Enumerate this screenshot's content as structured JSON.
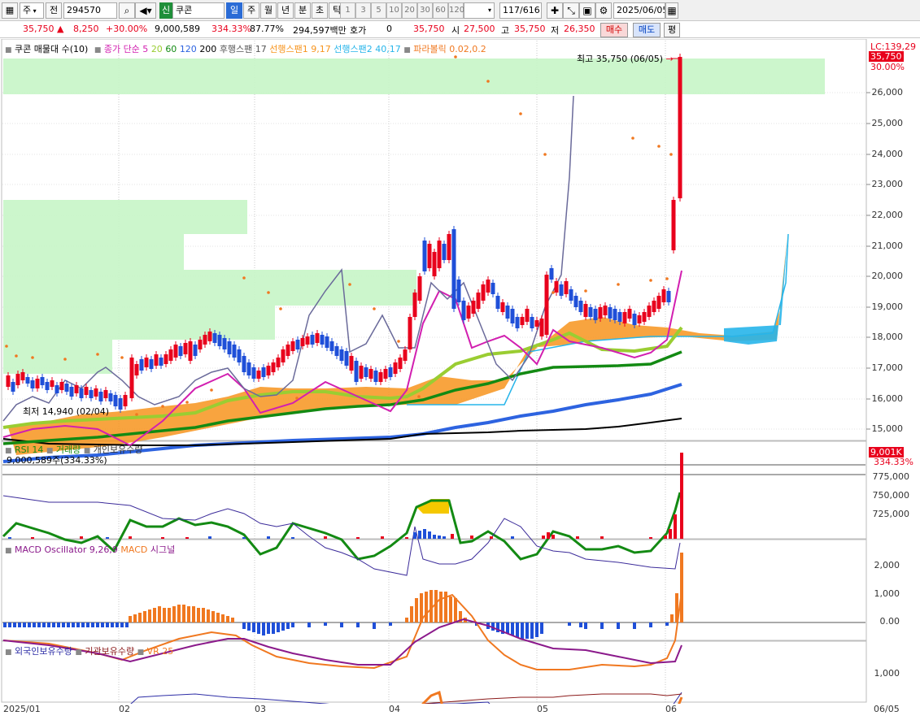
{
  "toolbar": {
    "period_type": "주",
    "prev_label": "전",
    "code": "294570",
    "sign": "신",
    "name": "쿠콘",
    "periods": [
      "일",
      "주",
      "월",
      "년",
      "분",
      "초",
      "틱"
    ],
    "intervals": [
      "1",
      "3",
      "5",
      "10",
      "20",
      "30",
      "60",
      "120"
    ],
    "count": "117/616",
    "date": "2025/06/05"
  },
  "quote": {
    "price": "35,750",
    "change": "8,250",
    "change_pct": "+30.00%",
    "volume": "9,000,589",
    "vol_pct": "334.33%",
    "ratio": "87.77%",
    "amount": "294,597백만",
    "hoga_label": "호가",
    "hoga_value": "0",
    "hoga_price": "35,750",
    "open_label": "시",
    "open": "27,500",
    "high_label": "고",
    "high": "35,750",
    "low_label": "저",
    "low": "26,350",
    "buy_label": "매수",
    "sell_label": "매도",
    "avg_label": "평"
  },
  "price_panel": {
    "legend": {
      "vp": "쿠콘 매물대 수(10)",
      "ma": "종가 단순 5",
      "ma20": "20",
      "ma60": "60",
      "ma120": "120",
      "ma200": "200",
      "lag": "후행스팬 17",
      "lead1": "선행스팬1 9,17",
      "lead2": "선행스팬2 40,17",
      "psar": "파라볼릭 0.02,0.2"
    },
    "lc_label": "LC:139,29",
    "price_tag": "35,750",
    "pct_tag": "30.00%",
    "high_note": "최고 35,750 (06/05)",
    "low_note": "최저 14,940 (02/04)",
    "y_ticks": [
      "26,000",
      "25,000",
      "24,000",
      "23,000",
      "22,000",
      "21,000",
      "20,000",
      "19,000",
      "18,000",
      "17,000",
      "16,000",
      "15,000"
    ],
    "colors": {
      "up": "#e8001c",
      "down": "#1f4fd8",
      "ma5": "#d21fb0",
      "ma20": "#9acd32",
      "ma60": "#138a13",
      "ma120": "#2d63e0",
      "ma200": "#000000",
      "lead_fill": "#f7941d",
      "lead_fill_down": "#27b5ea",
      "psar": "#f07820",
      "vp": "#c7f5c7"
    }
  },
  "rsi_panel": {
    "legend_rsi": "RSI 14",
    "legend_vol": "거래량",
    "legend_ind": "개인보유수량",
    "vol_note": "9,000,589주(334.33%)",
    "tag_vol": "9,001K",
    "tag_pct": "334.33%",
    "y_ticks": [
      "775,000",
      "750,000",
      "725,000"
    ]
  },
  "macd_panel": {
    "legend_osc": "MACD Oscillator 9,26,9",
    "legend_macd": "MACD",
    "legend_sig": "시그널",
    "y_ticks": [
      "2,000",
      "1,000",
      "0.00"
    ]
  },
  "inv_panel": {
    "legend_for": "외국인보유수량",
    "legend_inst": "기관보유수량",
    "legend_vr": "VR 25",
    "y_ticks": [
      "1,000"
    ]
  },
  "x_axis": [
    "2025/01",
    "02",
    "03",
    "04",
    "05",
    "06",
    "06/05"
  ]
}
